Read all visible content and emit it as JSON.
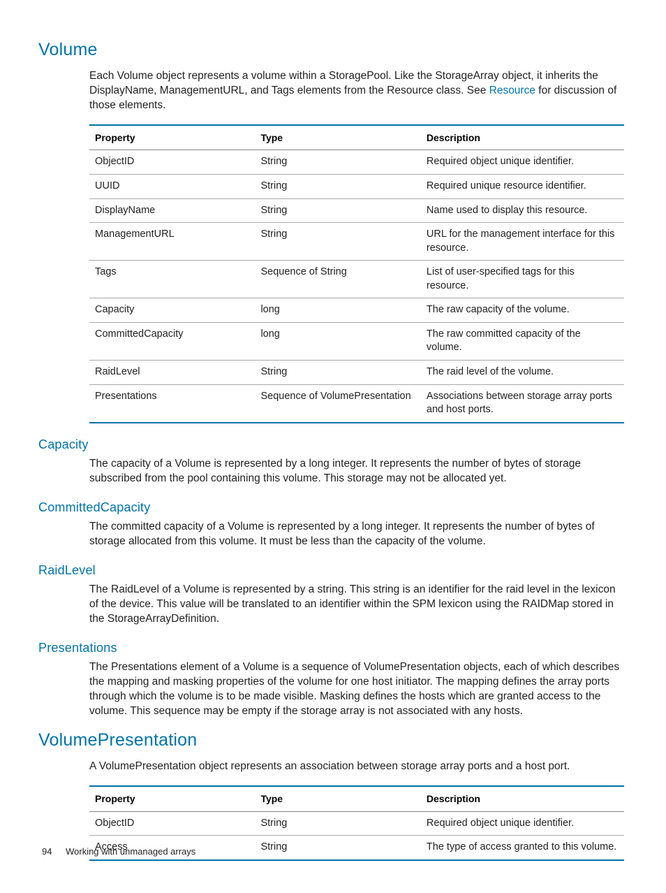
{
  "sections": {
    "volume": {
      "title": "Volume",
      "intro_pre": "Each Volume object represents a volume within a StoragePool. Like the StorageArray object, it inherits the DisplayName, ManagementURL, and Tags elements from the Resource class. See ",
      "intro_link": "Resource",
      "intro_post": " for discussion of those elements.",
      "table": {
        "headers": {
          "prop": "Property",
          "type": "Type",
          "desc": "Description"
        },
        "rows": [
          {
            "prop": "ObjectID",
            "type": "String",
            "desc": "Required object unique identifier."
          },
          {
            "prop": "UUID",
            "type": "String",
            "desc": "Required unique resource identifier."
          },
          {
            "prop": "DisplayName",
            "type": "String",
            "desc": "Name used to display this resource."
          },
          {
            "prop": "ManagementURL",
            "type": "String",
            "desc": "URL for the management interface for this resource."
          },
          {
            "prop": "Tags",
            "type": "Sequence of String",
            "desc": "List of user-specified tags for this resource."
          },
          {
            "prop": "Capacity",
            "type": "long",
            "desc": "The raw capacity of the volume."
          },
          {
            "prop": "CommittedCapacity",
            "type": "long",
            "desc": "The raw committed capacity of the volume."
          },
          {
            "prop": "RaidLevel",
            "type": "String",
            "desc": "The raid level of the volume."
          },
          {
            "prop": "Presentations",
            "type": "Sequence of VolumePresentation",
            "desc": "Associations between storage array ports and host ports."
          }
        ]
      },
      "subsections": [
        {
          "title": "Capacity",
          "body": "The capacity of a Volume is represented by a long integer. It represents the number of bytes of storage subscribed from the pool containing this volume. This storage may not be allocated yet."
        },
        {
          "title": "CommittedCapacity",
          "body": "The committed capacity of a Volume is represented by a long integer. It represents the number of bytes of storage allocated from this volume. It must be less than the capacity of the volume."
        },
        {
          "title": "RaidLevel",
          "body": "The RaidLevel of a Volume is represented by a string. This string is an identifier for the raid level in the lexicon of the device. This value will be translated to an identifier within the SPM lexicon using the RAIDMap stored in the StorageArrayDefinition."
        },
        {
          "title": "Presentations",
          "body": "The Presentations element of a Volume is a sequence of VolumePresentation objects, each of which describes the mapping and masking properties of the volume for one host initiator. The mapping defines the array ports through which the volume is to be made visible. Masking defines the hosts which are granted access to the volume. This sequence may be empty if the storage array is not associated with any hosts."
        }
      ]
    },
    "volumepresentation": {
      "title": "VolumePresentation",
      "intro": "A VolumePresentation object represents an association between storage array ports and a host port.",
      "table": {
        "headers": {
          "prop": "Property",
          "type": "Type",
          "desc": "Description"
        },
        "rows": [
          {
            "prop": "ObjectID",
            "type": "String",
            "desc": "Required object unique identifier."
          },
          {
            "prop": "Access",
            "type": "String",
            "desc": "The type of access granted to this volume."
          }
        ]
      }
    }
  },
  "footer": {
    "page": "94",
    "chapter": "Working with unmanaged arrays"
  }
}
